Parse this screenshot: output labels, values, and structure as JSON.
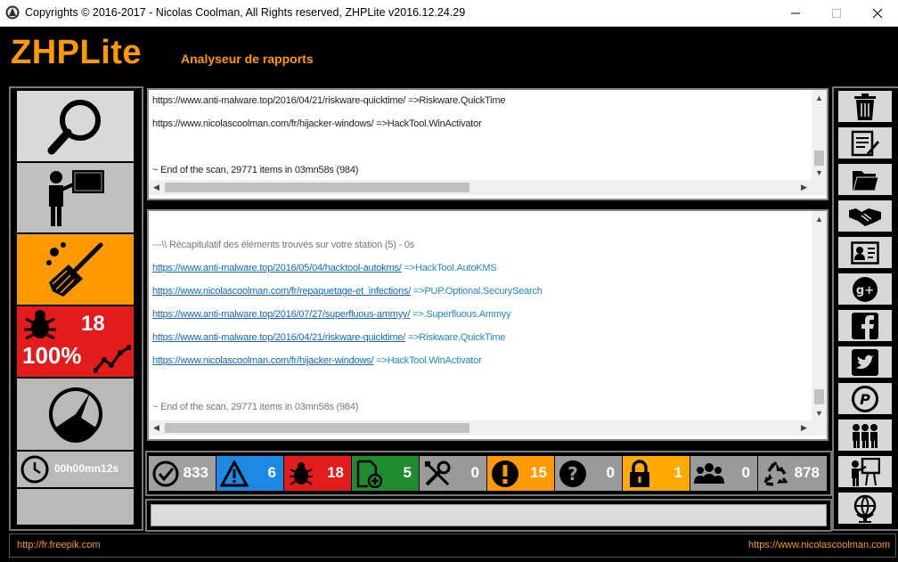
{
  "window": {
    "title": "Copyrights © 2016-2017 - Nicolas Coolman, All Rights reserved,  ZHPLite v2016.12.24.29",
    "minimize_icon": "minimize-icon",
    "maximize_icon": "maximize-icon",
    "close_icon": "close-icon"
  },
  "header": {
    "app_name": "ZHPLite",
    "subtitle": "Analyseur de rapports"
  },
  "left_panel": {
    "tiles": [
      {
        "icon": "search-icon",
        "color": "#d9d9d9"
      },
      {
        "icon": "presenter-icon",
        "color": "#c0c0c0"
      },
      {
        "icon": "broom-icon",
        "color": "#ff9900"
      },
      {
        "icon": "bug-icon",
        "color": "#e31b1b",
        "count": "18",
        "percent": "100%"
      },
      {
        "icon": "speedometer-icon",
        "color": "#b9b9b9"
      },
      {
        "icon": "clock-icon",
        "color": "#b9b9b9",
        "timer": "00h00mn12s"
      }
    ]
  },
  "top_report": {
    "lines": [
      {
        "url": "https://www.anti-malware.top/2016/04/21/riskware-quicktime/",
        "result": "=>Riskware.QuickTime"
      },
      {
        "url": "https://www.nicolascoolman.com/fr/hijacker-windows/",
        "result": "=>HackTool.WinActivator"
      }
    ],
    "end_line": "~ End of the scan, 29771 items in 03mn58s (984)"
  },
  "bottom_report": {
    "header_line": "---\\\\  Récapitulatif des éléments trouvés sur votre station (5) - 0s",
    "lines": [
      {
        "url": "https://www.anti-malware.top/2016/05/04/hacktool-autokms/",
        "result": "=>HackTool.AutoKMS"
      },
      {
        "url": "https://www.nicolascoolman.com/fr/repaquetage-et_infections/",
        "result": "=>PUP.Optional.SecurySearch"
      },
      {
        "url": "https://www.anti-malware.top/2016/07/27/superfluous-ammyy/",
        "result": "=>.Superfluous.Ammyy"
      },
      {
        "url": "https://www.anti-malware.top/2016/04/21/riskware-quicktime/",
        "result": "=>Riskware.QuickTime"
      },
      {
        "url": "https://www.nicolascoolman.com/fr/hijacker-windows/",
        "result": "=>HackTool.WinActivator"
      }
    ],
    "end_line": "~ End of the scan, 29771 items in 03mn58s (984)"
  },
  "stats": [
    {
      "icon": "check-circle-icon",
      "value": "833",
      "color": "#a0a0a0"
    },
    {
      "icon": "warning-icon",
      "value": "6",
      "color": "#1e88e5"
    },
    {
      "icon": "bug-icon",
      "value": "18",
      "color": "#e31b1b"
    },
    {
      "icon": "add-file-icon",
      "value": "5",
      "color": "#1e8c2e"
    },
    {
      "icon": "tools-icon",
      "value": "0",
      "color": "#9a9a9a"
    },
    {
      "icon": "exclamation-icon",
      "value": "15",
      "color": "#ff9900"
    },
    {
      "icon": "question-icon",
      "value": "0",
      "color": "#9a9a9a"
    },
    {
      "icon": "lock-icon",
      "value": "1",
      "color": "#ffaa00"
    },
    {
      "icon": "group-icon",
      "value": "0",
      "color": "#9a9a9a"
    },
    {
      "icon": "recycle-icon",
      "value": "878",
      "color": "#9a9a9a"
    }
  ],
  "right_toolbar": [
    "trash-icon",
    "edit-document-icon",
    "folder-icon",
    "handshake-icon",
    "contact-card-icon",
    "google-plus-icon",
    "facebook-icon",
    "twitter-icon",
    "paypal-icon",
    "people-icon",
    "presentation-icon",
    "globe-icon"
  ],
  "footer": {
    "left_link": "http://fr.freepik.com",
    "right_link": "https://www.nicolascoolman.com"
  }
}
